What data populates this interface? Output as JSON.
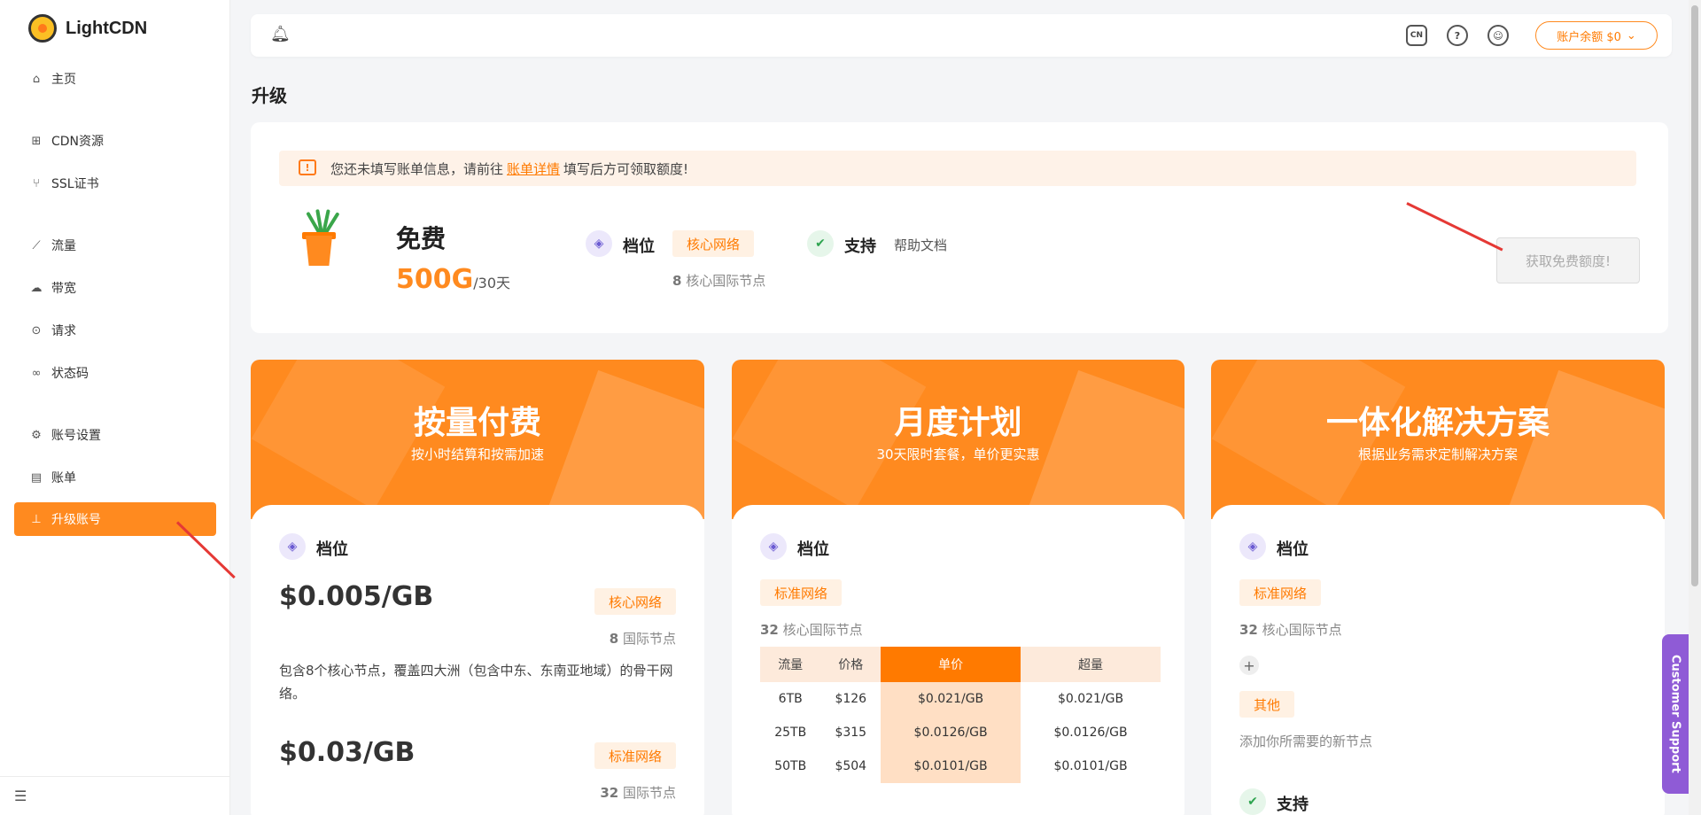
{
  "sidebar": {
    "logo": "LightCDN",
    "items": [
      {
        "label": "主页",
        "icon": "home-icon"
      },
      {
        "label": "CDN资源",
        "icon": "grid-icon"
      },
      {
        "label": "SSL证书",
        "icon": "branch-icon"
      },
      {
        "label": "流量",
        "icon": "line-chart-icon"
      },
      {
        "label": "带宽",
        "icon": "cloud-upload-icon"
      },
      {
        "label": "请求",
        "icon": "dots-circle-icon"
      },
      {
        "label": "状态码",
        "icon": "link-icon"
      },
      {
        "label": "账号设置",
        "icon": "gear-icon"
      },
      {
        "label": "账单",
        "icon": "list-icon"
      },
      {
        "label": "升级账号",
        "icon": "upload-icon",
        "active": true
      }
    ]
  },
  "header": {
    "lang_badge": "CN",
    "help_symbol": "?",
    "balance_label": "账户余额 $0"
  },
  "page": {
    "title": "升级"
  },
  "notice": {
    "before": "您还未填写账单信息，请前往",
    "link": "账单详情",
    "after": "填写后方可领取额度!"
  },
  "free": {
    "title": "免费",
    "amount": "500G",
    "period": "/30天",
    "tier_label": "档位",
    "tier_badge": "核心网络",
    "nodes_count": "8",
    "nodes_text": "核心国际节点",
    "support_label": "支持",
    "support_value": "帮助文档",
    "claim_button": "获取免费额度!"
  },
  "plans": [
    {
      "title": "按量付费",
      "subtitle": "按小时结算和按需加速",
      "tier_label": "档位",
      "rows": [
        {
          "price": "$0.005/GB",
          "badge": "核心网络",
          "nodes_count": "8",
          "nodes_text": "国际节点",
          "desc": "包含8个核心节点，覆盖四大洲（包含中东、东南亚地域）的骨干网络。"
        },
        {
          "price": "$0.03/GB",
          "badge": "标准网络",
          "nodes_count": "32",
          "nodes_text": "国际节点"
        }
      ]
    },
    {
      "title": "月度计划",
      "subtitle": "30天限时套餐，单价更实惠",
      "tier_label": "档位",
      "badge": "标准网络",
      "nodes_count": "32",
      "nodes_text": "核心国际节点",
      "table": {
        "headers": [
          "流量",
          "价格",
          "单价",
          "超量"
        ],
        "rows": [
          [
            "6TB",
            "$126",
            "$0.021/GB",
            "$0.021/GB"
          ],
          [
            "25TB",
            "$315",
            "$0.0126/GB",
            "$0.0126/GB"
          ],
          [
            "50TB",
            "$504",
            "$0.0101/GB",
            "$0.0101/GB"
          ]
        ]
      }
    },
    {
      "title": "一体化解决方案",
      "subtitle": "根据业务需求定制解决方案",
      "tier_label": "档位",
      "badge": "标准网络",
      "nodes_count": "32",
      "nodes_text": "核心国际节点",
      "other_badge": "其他",
      "other_text": "添加你所需要的新节点",
      "support_label": "支持"
    }
  ],
  "customer_support": "Customer Support",
  "colors": {
    "accent": "#ff8a1f",
    "accent_dark": "#ff7a00",
    "badge_bg": "#fff1e3"
  }
}
